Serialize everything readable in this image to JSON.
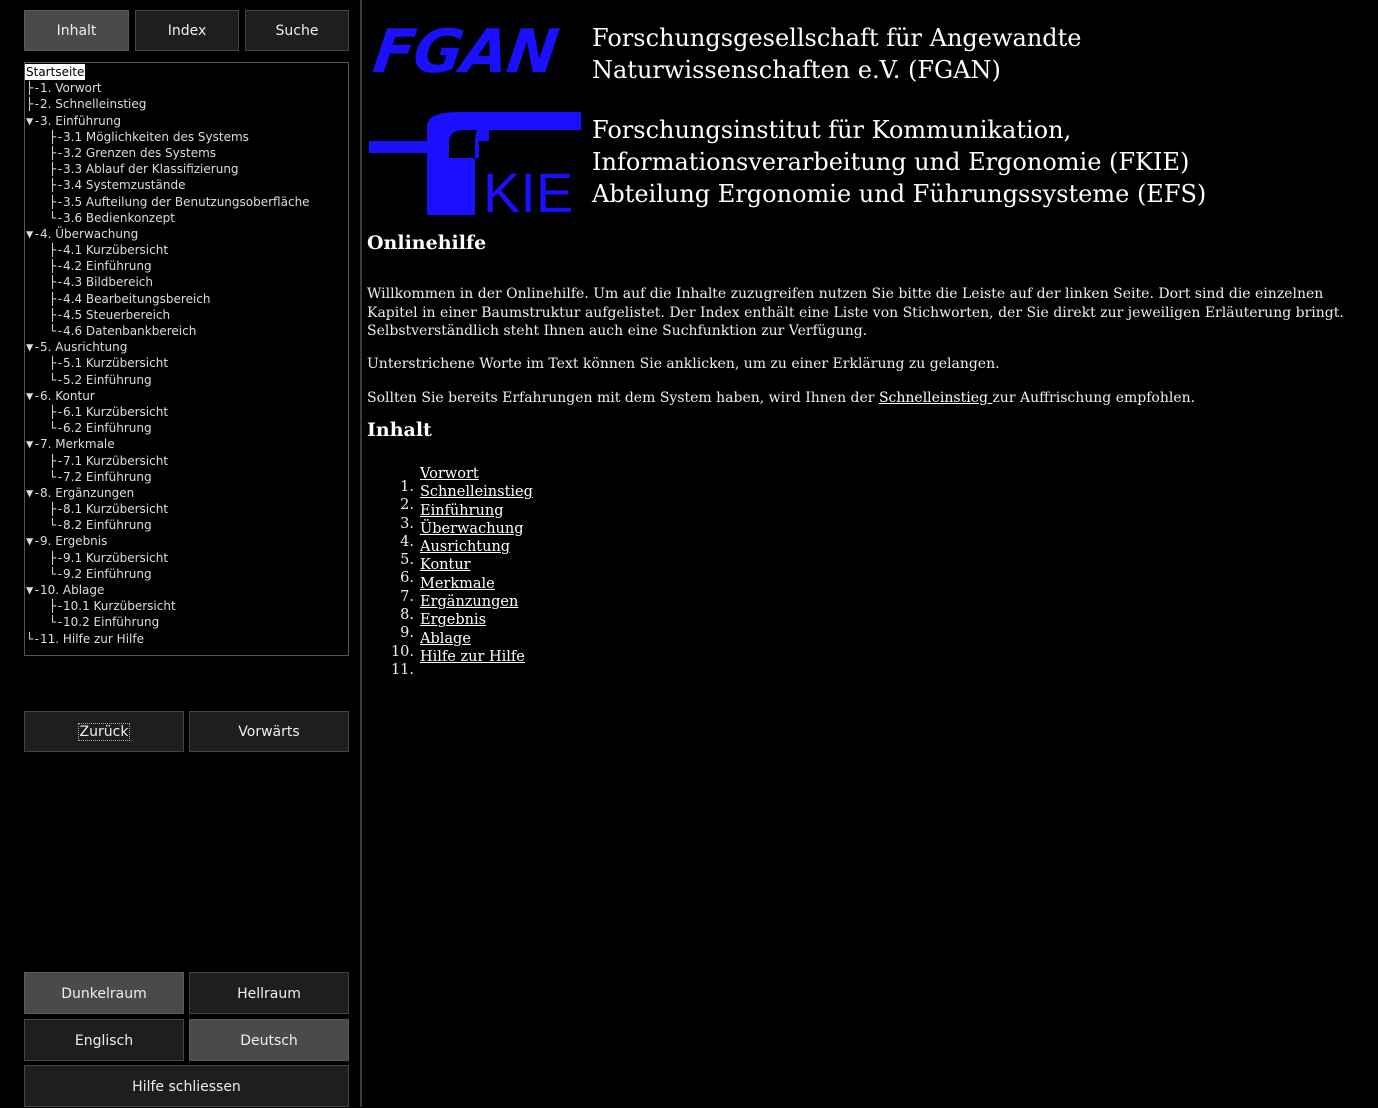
{
  "tabs": [
    "Inhalt",
    "Index",
    "Suche"
  ],
  "tree": [
    {
      "label": "Startseite",
      "conn": "",
      "indent": 0,
      "selected": true
    },
    {
      "label": "1. Vorwort",
      "conn": "├-",
      "indent": 0
    },
    {
      "label": "2. Schnelleinstieg",
      "conn": "├-",
      "indent": 0
    },
    {
      "label": "3. Einführung",
      "conn": "▼-",
      "indent": 0
    },
    {
      "label": "3.1 Möglichkeiten des Systems",
      "conn": "├-",
      "indent": 1
    },
    {
      "label": "3.2 Grenzen des Systems",
      "conn": "├-",
      "indent": 1
    },
    {
      "label": "3.3 Ablauf der Klassifizierung",
      "conn": "├-",
      "indent": 1
    },
    {
      "label": "3.4 Systemzustände",
      "conn": "├-",
      "indent": 1
    },
    {
      "label": "3.5 Aufteilung der Benutzungsoberfläche",
      "conn": "├-",
      "indent": 1
    },
    {
      "label": "3.6 Bedienkonzept",
      "conn": "└-",
      "indent": 1
    },
    {
      "label": "4. Überwachung",
      "conn": "▼-",
      "indent": 0
    },
    {
      "label": "4.1 Kurzübersicht",
      "conn": "├-",
      "indent": 1
    },
    {
      "label": "4.2 Einführung",
      "conn": "├-",
      "indent": 1
    },
    {
      "label": "4.3 Bildbereich",
      "conn": "├-",
      "indent": 1
    },
    {
      "label": "4.4 Bearbeitungsbereich",
      "conn": "├-",
      "indent": 1
    },
    {
      "label": "4.5 Steuerbereich",
      "conn": "├-",
      "indent": 1
    },
    {
      "label": "4.6 Datenbankbereich",
      "conn": "└-",
      "indent": 1
    },
    {
      "label": "5. Ausrichtung",
      "conn": "▼-",
      "indent": 0
    },
    {
      "label": "5.1 Kurzübersicht",
      "conn": "├-",
      "indent": 1
    },
    {
      "label": "5.2 Einführung",
      "conn": "└-",
      "indent": 1
    },
    {
      "label": "6. Kontur",
      "conn": "▼-",
      "indent": 0
    },
    {
      "label": "6.1 Kurzübersicht",
      "conn": "├-",
      "indent": 1
    },
    {
      "label": "6.2 Einführung",
      "conn": "└-",
      "indent": 1
    },
    {
      "label": "7. Merkmale",
      "conn": "▼-",
      "indent": 0
    },
    {
      "label": "7.1 Kurzübersicht",
      "conn": "├-",
      "indent": 1
    },
    {
      "label": "7.2 Einführung",
      "conn": "└-",
      "indent": 1
    },
    {
      "label": "8. Ergänzungen",
      "conn": "▼-",
      "indent": 0
    },
    {
      "label": "8.1 Kurzübersicht",
      "conn": "├-",
      "indent": 1
    },
    {
      "label": "8.2 Einführung",
      "conn": "└-",
      "indent": 1
    },
    {
      "label": "9. Ergebnis",
      "conn": "▼-",
      "indent": 0
    },
    {
      "label": "9.1 Kurzübersicht",
      "conn": "├-",
      "indent": 1
    },
    {
      "label": "9.2 Einführung",
      "conn": "└-",
      "indent": 1
    },
    {
      "label": "10. Ablage",
      "conn": "▼-",
      "indent": 0
    },
    {
      "label": "10.1 Kurzübersicht",
      "conn": "├-",
      "indent": 1
    },
    {
      "label": "10.2 Einführung",
      "conn": "└-",
      "indent": 1
    },
    {
      "label": "11. Hilfe zur Hilfe",
      "conn": "└-",
      "indent": 0
    }
  ],
  "nav": {
    "back": "Zurück",
    "forward": "Vorwärts"
  },
  "mode": {
    "dark": "Dunkelraum",
    "light": "Hellraum"
  },
  "lang": {
    "english": "Englisch",
    "german": "Deutsch"
  },
  "close_label": "Hilfe schliessen",
  "header": {
    "fgan_logo": "FGAN",
    "fgan_line1": "Forschungsgesellschaft für Angewandte",
    "fgan_line2": "Naturwissenschaften e.V. (FGAN)",
    "fkie_logo": "KIE",
    "fkie_line1": "Forschungsinstitut für Kommunikation,",
    "fkie_line2": "Informationsverarbeitung und Ergonomie (FKIE)",
    "fkie_line3": "Abteilung Ergonomie und Führungssysteme (EFS)"
  },
  "main": {
    "heading": "Onlinehilfe",
    "intro": "Willkommen in der Onlinehilfe. Um auf die Inhalte zuzugreifen nutzen Sie bitte die Leiste auf der linken Seite. Dort sind die einzelnen Kapitel in einer Baumstruktur aufgelistet. Der Index enthält eine Liste von Stichworten, der Sie direkt zur jeweiligen Erläuterung bringt. Selbstverständlich steht Ihnen auch eine Suchfunktion zur Verfügung.",
    "para2": "Unterstrichene Worte im Text können Sie anklicken, um zu einer Erklärung zu gelangen.",
    "para3_before": "Sollten Sie bereits Erfahrungen mit dem System haben, wird Ihnen der ",
    "para3_link": "Schnelleinstieg ",
    "para3_after": "zur Auffrischung empfohlen.",
    "toc_heading": "Inhalt",
    "toc": [
      {
        "num": "1.",
        "label": "Vorwort "
      },
      {
        "num": "2.",
        "label": "Schnelleinstieg "
      },
      {
        "num": "3.",
        "label": "Einführung "
      },
      {
        "num": "4.",
        "label": "Überwachung "
      },
      {
        "num": "5.",
        "label": "Ausrichtung "
      },
      {
        "num": "6.",
        "label": "Kontur "
      },
      {
        "num": "7.",
        "label": "Merkmale "
      },
      {
        "num": "8.",
        "label": "Ergänzungen "
      },
      {
        "num": "9.",
        "label": "Ergebnis "
      },
      {
        "num": "10.",
        "label": "Ablage "
      },
      {
        "num": "11.",
        "label": "Hilfe zur Hilfe"
      }
    ]
  },
  "colors": {
    "logo_blue": "#1a10ff",
    "background": "#000000",
    "button": "#1e1e1e",
    "button_active": "#4a4a4a"
  }
}
